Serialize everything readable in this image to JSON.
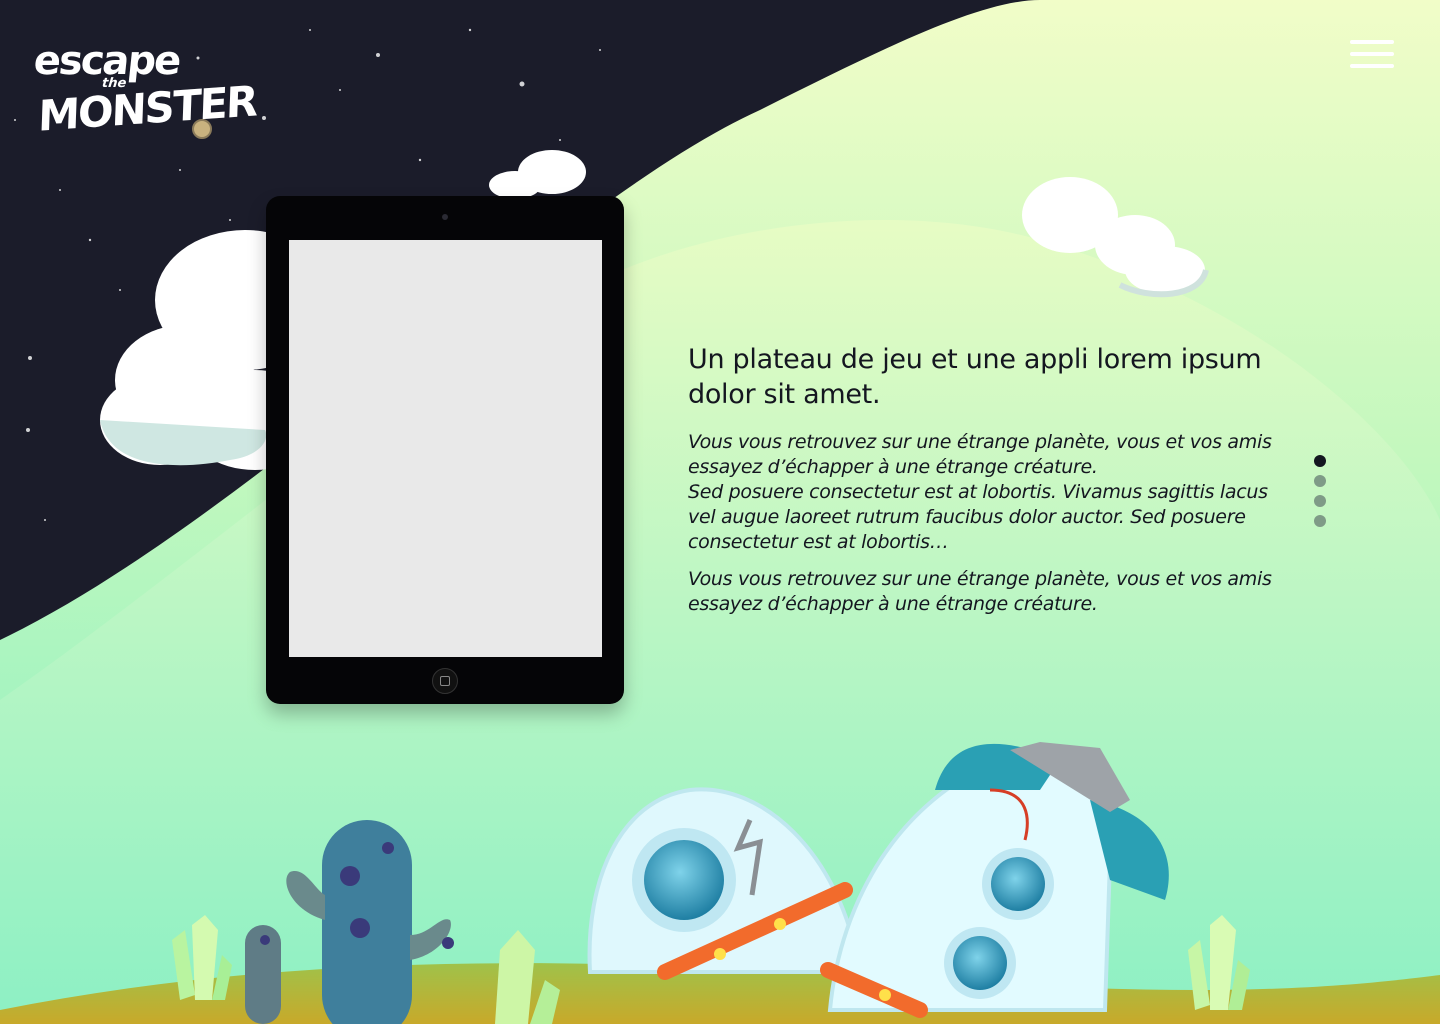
{
  "brand": {
    "logo_line1": "escape",
    "logo_the": "the",
    "logo_line2": "MONSTER"
  },
  "header": {
    "menu_icon": "hamburger-menu-icon"
  },
  "hero": {
    "device_icon": "tablet-mockup",
    "headline": "Un plateau de jeu et une appli lorem ipsum dolor sit amet.",
    "paragraph_1": "Vous vous retrouvez sur une étrange planète, vous et vos amis essayez d’échapper à une étrange créature.\nSed posuere consectetur est at lobortis. Vivamus sagittis lacus vel augue laoreet rutrum faucibus dolor auctor. Sed posuere consectetur est at lobortis…",
    "paragraph_2": "Vous vous retrouvez sur une étrange planète, vous et vos amis essayez d’échapper à une étrange créature."
  },
  "pagination": {
    "count": 4,
    "active_index": 0
  },
  "colors": {
    "space": "#1b1c2a",
    "hill_light": "#eafcc4",
    "hill_mint": "#8ef0c2",
    "ground": "#c9b02a",
    "text_dark": "#141620"
  }
}
